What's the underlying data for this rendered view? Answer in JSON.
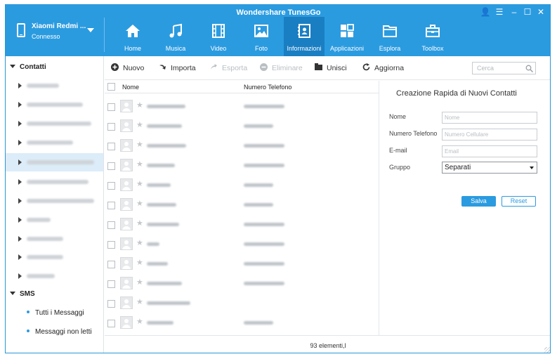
{
  "window": {
    "title": "Wondershare TunesGo",
    "controls": [
      "user-icon",
      "menu-icon",
      "minimize-icon",
      "maximize-icon",
      "close-icon"
    ],
    "control_glyphs": [
      "👤",
      "☰",
      "–",
      "☐",
      "✕"
    ]
  },
  "device": {
    "name": "Xiaomi Redmi ...",
    "status": "Connesso"
  },
  "nav": [
    {
      "label": "Home",
      "icon": "home-icon"
    },
    {
      "label": "Musica",
      "icon": "music-icon"
    },
    {
      "label": "Video",
      "icon": "video-icon"
    },
    {
      "label": "Foto",
      "icon": "photo-icon"
    },
    {
      "label": "Informazioni",
      "icon": "contacts-book-icon",
      "active": true
    },
    {
      "label": "Applicazioni",
      "icon": "apps-icon"
    },
    {
      "label": "Esplora",
      "icon": "folder-icon"
    },
    {
      "label": "Toolbox",
      "icon": "toolbox-icon"
    }
  ],
  "sidebar": {
    "contacts_header": "Contatti",
    "sms_header": "SMS",
    "accounts_count": 11,
    "selected_account": 4,
    "sms_items": [
      "Tutti i Messaggi",
      "Messaggi non letti"
    ]
  },
  "toolbar": {
    "new": "Nuovo",
    "import": "Importa",
    "export": "Esporta",
    "delete": "Eliminare",
    "merge": "Unisci",
    "refresh": "Aggiorna",
    "search_placeholder": "Cerca"
  },
  "list": {
    "col_name": "Nome",
    "col_phone": "Numero Telefono",
    "visible_rows": 12
  },
  "form": {
    "title": "Creazione Rapida di Nuovi Contatti",
    "name_label": "Nome",
    "name_placeholder": "Nome",
    "phone_label": "Numero Telefono",
    "phone_placeholder": "Numero Cellulare",
    "email_label": "E-mail",
    "email_placeholder": "Email",
    "group_label": "Gruppo",
    "group_value": "Separati",
    "save": "Salva",
    "reset": "Reset"
  },
  "status": {
    "text": "93 elementi,l"
  },
  "colors": {
    "accent": "#2b9be0",
    "active_nav": "#1a7ec3",
    "selected_row": "#dcecf9"
  }
}
